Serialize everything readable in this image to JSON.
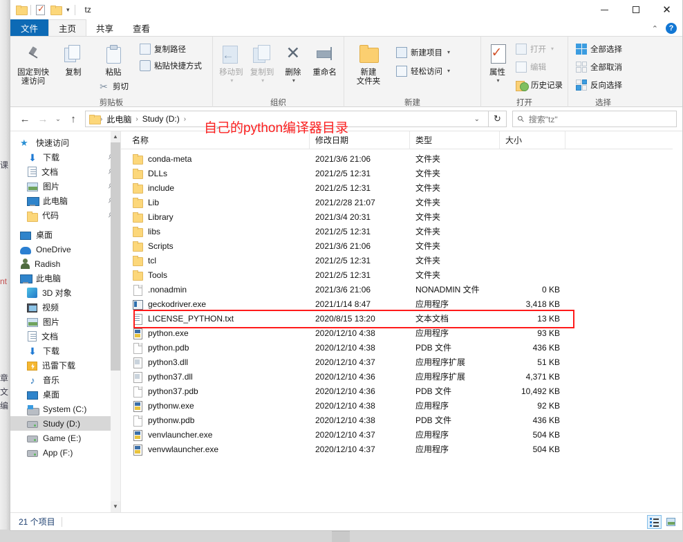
{
  "window": {
    "title": "tz",
    "quick_access_icons": [
      "folder-icon",
      "properties-icon",
      "new-folder-icon"
    ],
    "controls": {
      "minimize": "minimize-button",
      "maximize": "maximize-button",
      "close": "close-button"
    }
  },
  "tabs": [
    {
      "label": "文件",
      "name": "tab-file",
      "state": "file"
    },
    {
      "label": "主页",
      "name": "tab-home",
      "state": "active"
    },
    {
      "label": "共享",
      "name": "tab-share",
      "state": "normal"
    },
    {
      "label": "查看",
      "name": "tab-view",
      "state": "normal"
    }
  ],
  "tabbar_right": {
    "collapse": "⌃",
    "help": "?"
  },
  "ribbon": {
    "groups": [
      {
        "title": "剪贴板",
        "name": "ribbon-group-clipboard",
        "big": [
          {
            "label": "固定到快\n速访问",
            "icon": "pin-icon",
            "name": "pin-to-quick-access-button",
            "dim": false
          },
          {
            "label": "复制",
            "icon": "copy-icon",
            "name": "copy-button",
            "dim": false
          },
          {
            "label": "粘贴",
            "icon": "paste-icon",
            "name": "paste-button",
            "dim": false
          }
        ],
        "small": [
          {
            "label": "复制路径",
            "icon": "copy-path-icon",
            "name": "copy-path-button"
          },
          {
            "label": "粘贴快捷方式",
            "icon": "paste-shortcut-icon",
            "name": "paste-shortcut-button"
          },
          {
            "label": "剪切",
            "icon": "scissors-icon",
            "name": "cut-button"
          }
        ]
      },
      {
        "title": "组织",
        "name": "ribbon-group-organize",
        "big": [
          {
            "label": "移动到",
            "icon": "move-to-icon",
            "name": "move-to-button",
            "dim": true,
            "caret": true
          },
          {
            "label": "复制到",
            "icon": "copy-to-icon",
            "name": "copy-to-button",
            "dim": true,
            "caret": true
          },
          {
            "label": "删除",
            "icon": "delete-icon",
            "name": "delete-button",
            "dim": false,
            "caret": true
          },
          {
            "label": "重命名",
            "icon": "rename-icon",
            "name": "rename-button",
            "dim": false
          }
        ],
        "small": []
      },
      {
        "title": "新建",
        "name": "ribbon-group-new",
        "big": [
          {
            "label": "新建\n文件夹",
            "icon": "new-folder-icon",
            "name": "new-folder-button",
            "dim": false
          }
        ],
        "small": [
          {
            "label": "新建项目",
            "icon": "new-item-icon",
            "name": "new-item-button",
            "caret": true
          },
          {
            "label": "轻松访问",
            "icon": "easy-access-icon",
            "name": "easy-access-button",
            "caret": true
          }
        ]
      },
      {
        "title": "打开",
        "name": "ribbon-group-open",
        "big": [
          {
            "label": "属性",
            "icon": "properties-icon",
            "name": "properties-button",
            "dim": false,
            "caret": true
          }
        ],
        "small": [
          {
            "label": "打开",
            "icon": "open-icon",
            "name": "open-button",
            "dim": true,
            "caret": true
          },
          {
            "label": "编辑",
            "icon": "edit-icon",
            "name": "edit-button",
            "dim": true
          },
          {
            "label": "历史记录",
            "icon": "history-icon",
            "name": "history-button",
            "dim": false
          }
        ]
      },
      {
        "title": "选择",
        "name": "ribbon-group-select",
        "big": [],
        "small": [
          {
            "label": "全部选择",
            "icon": "select-all-icon",
            "name": "select-all-button"
          },
          {
            "label": "全部取消",
            "icon": "select-none-icon",
            "name": "select-none-button"
          },
          {
            "label": "反向选择",
            "icon": "invert-selection-icon",
            "name": "invert-selection-button"
          }
        ]
      }
    ]
  },
  "address": {
    "back": "←",
    "forward": "→",
    "recent": "⌄",
    "up": "↑",
    "breadcrumbs": [
      "此电脑",
      "Study (D:)"
    ],
    "dropdown_caret": "⌄",
    "refresh": "↻"
  },
  "search": {
    "placeholder": "搜索\"tz\"",
    "icon": "search-icon"
  },
  "annotation": {
    "text": "自己的python编译器目录",
    "color": "#fb2020"
  },
  "nav_pane": {
    "items": [
      {
        "label": "快速访问",
        "icon": "star-icon",
        "indent": 0,
        "pinned": false,
        "selected": false
      },
      {
        "label": "下载",
        "icon": "download-icon",
        "indent": 1,
        "pinned": true,
        "selected": false
      },
      {
        "label": "文档",
        "icon": "document-icon",
        "indent": 1,
        "pinned": true,
        "selected": false
      },
      {
        "label": "图片",
        "icon": "pictures-icon",
        "indent": 1,
        "pinned": true,
        "selected": false
      },
      {
        "label": "此电脑",
        "icon": "this-pc-icon",
        "indent": 1,
        "pinned": true,
        "selected": false
      },
      {
        "label": "代码",
        "icon": "folder-icon",
        "indent": 1,
        "pinned": true,
        "selected": false
      },
      {
        "label": "桌面",
        "icon": "desktop-icon",
        "indent": 0,
        "pinned": false,
        "selected": false,
        "gap": true
      },
      {
        "label": "OneDrive",
        "icon": "cloud-icon",
        "indent": 0,
        "pinned": false,
        "selected": false
      },
      {
        "label": "Radish",
        "icon": "user-icon",
        "indent": 0,
        "pinned": false,
        "selected": false
      },
      {
        "label": "此电脑",
        "icon": "this-pc-icon",
        "indent": 0,
        "pinned": false,
        "selected": false
      },
      {
        "label": "3D 对象",
        "icon": "3d-objects-icon",
        "indent": 1,
        "pinned": false,
        "selected": false
      },
      {
        "label": "视频",
        "icon": "videos-icon",
        "indent": 1,
        "pinned": false,
        "selected": false
      },
      {
        "label": "图片",
        "icon": "pictures-icon",
        "indent": 1,
        "pinned": false,
        "selected": false
      },
      {
        "label": "文档",
        "icon": "document-icon",
        "indent": 1,
        "pinned": false,
        "selected": false
      },
      {
        "label": "下载",
        "icon": "download-icon",
        "indent": 1,
        "pinned": false,
        "selected": false
      },
      {
        "label": "迅雷下载",
        "icon": "thunder-download-icon",
        "indent": 1,
        "pinned": false,
        "selected": false
      },
      {
        "label": "音乐",
        "icon": "music-icon",
        "indent": 1,
        "pinned": false,
        "selected": false
      },
      {
        "label": "桌面",
        "icon": "desktop-icon",
        "indent": 1,
        "pinned": false,
        "selected": false
      },
      {
        "label": "System (C:)",
        "icon": "system-drive-icon",
        "indent": 1,
        "pinned": false,
        "selected": false
      },
      {
        "label": "Study (D:)",
        "icon": "drive-icon",
        "indent": 1,
        "pinned": false,
        "selected": true
      },
      {
        "label": "Game (E:)",
        "icon": "drive-icon",
        "indent": 1,
        "pinned": false,
        "selected": false
      },
      {
        "label": "App (F:)",
        "icon": "drive-icon",
        "indent": 1,
        "pinned": false,
        "selected": false
      }
    ]
  },
  "file_list": {
    "columns": [
      {
        "label": "名称",
        "name": "column-name",
        "sorted": "asc"
      },
      {
        "label": "修改日期",
        "name": "column-date-modified"
      },
      {
        "label": "类型",
        "name": "column-type"
      },
      {
        "label": "大小",
        "name": "column-size"
      }
    ],
    "rows": [
      {
        "name": "conda-meta",
        "date": "2021/3/6 21:06",
        "type": "文件夹",
        "size": "",
        "icon": "folder-icon",
        "highlight": false
      },
      {
        "name": "DLLs",
        "date": "2021/2/5 12:31",
        "type": "文件夹",
        "size": "",
        "icon": "folder-icon",
        "highlight": false
      },
      {
        "name": "include",
        "date": "2021/2/5 12:31",
        "type": "文件夹",
        "size": "",
        "icon": "folder-icon",
        "highlight": false
      },
      {
        "name": "Lib",
        "date": "2021/2/28 21:07",
        "type": "文件夹",
        "size": "",
        "icon": "folder-icon",
        "highlight": false
      },
      {
        "name": "Library",
        "date": "2021/3/4 20:31",
        "type": "文件夹",
        "size": "",
        "icon": "folder-icon",
        "highlight": false
      },
      {
        "name": "libs",
        "date": "2021/2/5 12:31",
        "type": "文件夹",
        "size": "",
        "icon": "folder-icon",
        "highlight": false
      },
      {
        "name": "Scripts",
        "date": "2021/3/6 21:06",
        "type": "文件夹",
        "size": "",
        "icon": "folder-icon",
        "highlight": false
      },
      {
        "name": "tcl",
        "date": "2021/2/5 12:31",
        "type": "文件夹",
        "size": "",
        "icon": "folder-icon",
        "highlight": false
      },
      {
        "name": "Tools",
        "date": "2021/2/5 12:31",
        "type": "文件夹",
        "size": "",
        "icon": "folder-icon",
        "highlight": false
      },
      {
        "name": ".nonadmin",
        "date": "2021/3/6 21:06",
        "type": "NONADMIN 文件",
        "size": "0 KB",
        "icon": "file-icon",
        "highlight": false
      },
      {
        "name": "geckodriver.exe",
        "date": "2021/1/14 8:47",
        "type": "应用程序",
        "size": "3,418 KB",
        "icon": "exe-icon",
        "highlight": true
      },
      {
        "name": "LICENSE_PYTHON.txt",
        "date": "2020/8/15 13:20",
        "type": "文本文档",
        "size": "13 KB",
        "icon": "text-icon",
        "highlight": false
      },
      {
        "name": "python.exe",
        "date": "2020/12/10 4:38",
        "type": "应用程序",
        "size": "93 KB",
        "icon": "python-icon",
        "highlight": false
      },
      {
        "name": "python.pdb",
        "date": "2020/12/10 4:38",
        "type": "PDB 文件",
        "size": "436 KB",
        "icon": "file-icon",
        "highlight": false
      },
      {
        "name": "python3.dll",
        "date": "2020/12/10 4:37",
        "type": "应用程序扩展",
        "size": "51 KB",
        "icon": "dll-icon",
        "highlight": false
      },
      {
        "name": "python37.dll",
        "date": "2020/12/10 4:36",
        "type": "应用程序扩展",
        "size": "4,371 KB",
        "icon": "dll-icon",
        "highlight": false
      },
      {
        "name": "python37.pdb",
        "date": "2020/12/10 4:36",
        "type": "PDB 文件",
        "size": "10,492 KB",
        "icon": "file-icon",
        "highlight": false
      },
      {
        "name": "pythonw.exe",
        "date": "2020/12/10 4:38",
        "type": "应用程序",
        "size": "92 KB",
        "icon": "python-icon",
        "highlight": false
      },
      {
        "name": "pythonw.pdb",
        "date": "2020/12/10 4:38",
        "type": "PDB 文件",
        "size": "436 KB",
        "icon": "file-icon",
        "highlight": false
      },
      {
        "name": "venvlauncher.exe",
        "date": "2020/12/10 4:37",
        "type": "应用程序",
        "size": "504 KB",
        "icon": "python-icon",
        "highlight": false
      },
      {
        "name": "venvwlauncher.exe",
        "date": "2020/12/10 4:37",
        "type": "应用程序",
        "size": "504 KB",
        "icon": "python-icon",
        "highlight": false
      }
    ]
  },
  "status": {
    "item_count": "21 个项目",
    "view_details": "details-view-button",
    "view_tiles": "tiles-view-button"
  }
}
